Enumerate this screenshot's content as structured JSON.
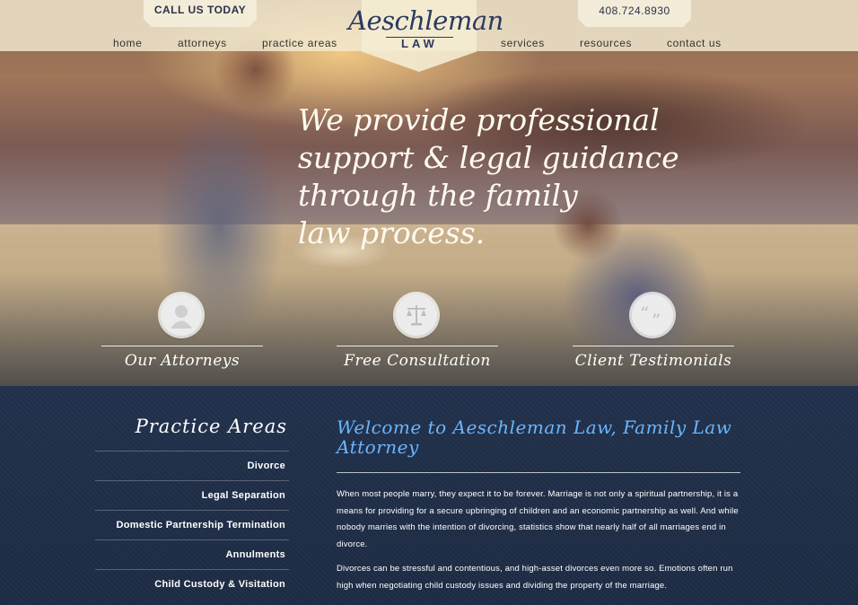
{
  "header": {
    "call_label": "CALL US TODAY",
    "phone": "408.724.8930",
    "logo_main": "Aeschleman",
    "logo_sub": "LAW"
  },
  "nav": {
    "items": [
      "home",
      "attorneys",
      "practice areas",
      "services",
      "resources",
      "contact us"
    ]
  },
  "hero": {
    "headline": [
      "We provide professional",
      "support & legal guidance",
      "through the family",
      "law process."
    ]
  },
  "features": [
    {
      "label": "Our Attorneys",
      "icon": "person-icon"
    },
    {
      "label": "Free Consultation",
      "icon": "scales-icon"
    },
    {
      "label": "Client Testimonials",
      "icon": "quote-icon"
    }
  ],
  "practice_areas": {
    "title": "Practice Areas",
    "items": [
      "Divorce",
      "Legal Separation",
      "Domestic Partnership Termination",
      "Annulments",
      "Child Custody & Visitation"
    ]
  },
  "content": {
    "welcome": "Welcome to Aeschleman Law, Family Law Attorney",
    "paragraphs": [
      "When most people marry, they expect it to be forever.  Marriage is not only a spiritual partnership, it is a means for providing for a secure upbringing of children and an economic partnership as well. And while nobody marries with the intention of divorcing, statistics show that nearly half of all marriages end in divorce.",
      "Divorces can be stressful and contentious, and high-asset divorces even more so.  Emotions often run high when negotiating child custody issues and dividing the property of the marriage."
    ]
  },
  "colors": {
    "navy": "#1e2d45",
    "link_blue": "#6ab6ff",
    "cream": "#f3ecd8"
  }
}
